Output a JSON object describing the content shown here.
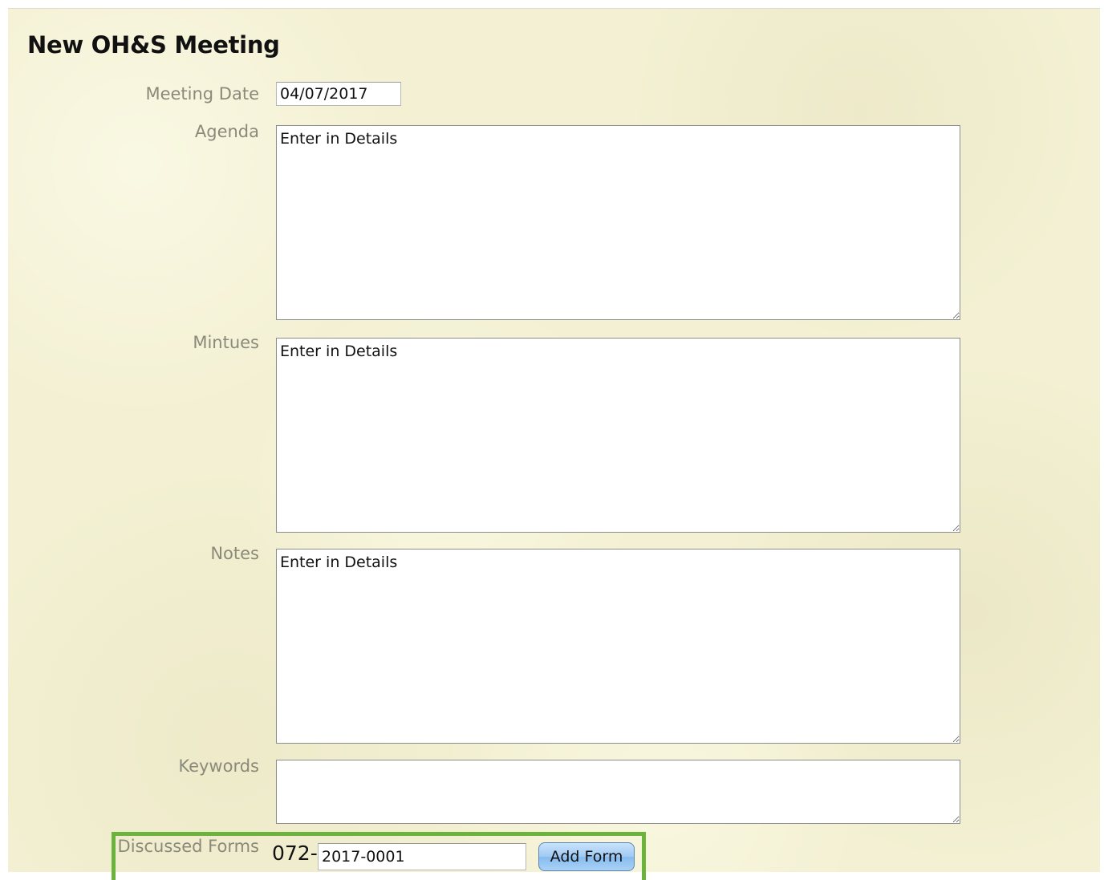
{
  "page_title": "New OH&S Meeting",
  "fields": {
    "meeting_date": {
      "label": "Meeting Date",
      "value": "04/07/2017"
    },
    "agenda": {
      "label": "Agenda",
      "value": "Enter in Details"
    },
    "minutes": {
      "label": "Mintues",
      "value": "Enter in Details"
    },
    "notes": {
      "label": "Notes",
      "value": "Enter in Details"
    },
    "keywords": {
      "label": "Keywords",
      "value": ""
    }
  },
  "discussed_forms": {
    "label": "Discussed Forms",
    "prefix": "072-",
    "value": "2017-0001",
    "button_label": "Add Form",
    "highlight_color": "#6cb33e"
  }
}
